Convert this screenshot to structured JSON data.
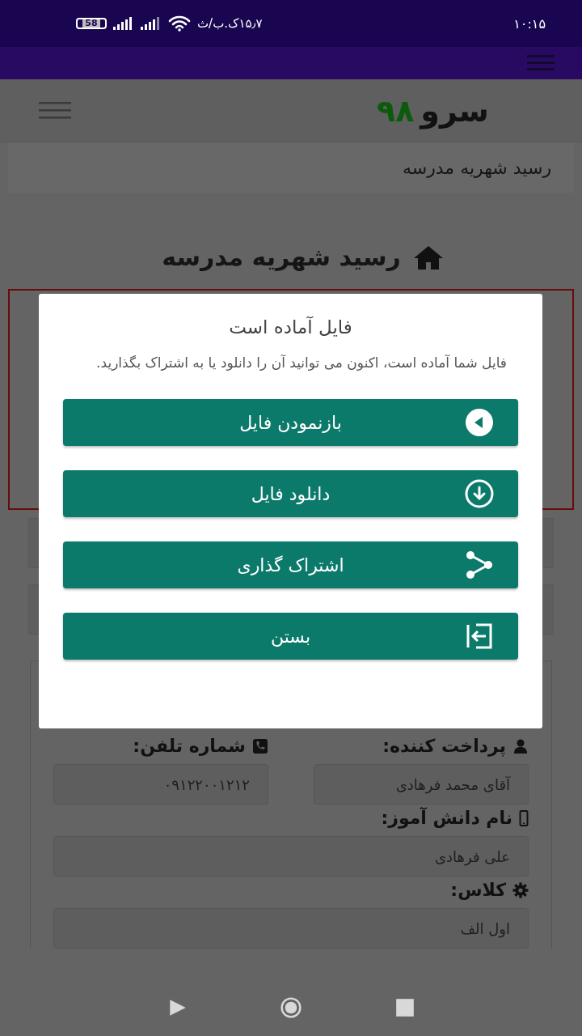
{
  "status_bar": {
    "time": "۱۰:۱۵",
    "network_speed": "۱۵٫۷ک.ب/ث",
    "battery": "58"
  },
  "header": {
    "logo_text": "سرو",
    "logo_number": "۹۸"
  },
  "breadcrumb": "رسید شهریه مدرسه",
  "page_title": "رسید شهریه مدرسه",
  "form": {
    "rows": [
      {
        "fields": [
          {
            "label": "پرداخت کننده:",
            "value": "آقای محمد فرهادی"
          },
          {
            "label": "شماره تلفن:",
            "value": "۰۹۱۲۲۰۰۱۲۱۲"
          }
        ]
      },
      {
        "fields": [
          {
            "label": "نام دانش آموز:",
            "value": "علی فرهادی"
          }
        ]
      },
      {
        "fields": [
          {
            "label": "کلاس:",
            "value": "اول الف"
          }
        ]
      }
    ]
  },
  "dialog": {
    "title": "فایل آماده است",
    "message": "فایل شما آماده است، اکنون می توانید آن را دانلود یا به اشتراک بگذارید.",
    "buttons": [
      {
        "label": "بازنمودن فایل"
      },
      {
        "label": "دانلود فایل"
      },
      {
        "label": "اشتراک گذاری"
      },
      {
        "label": "بستن"
      }
    ]
  }
}
